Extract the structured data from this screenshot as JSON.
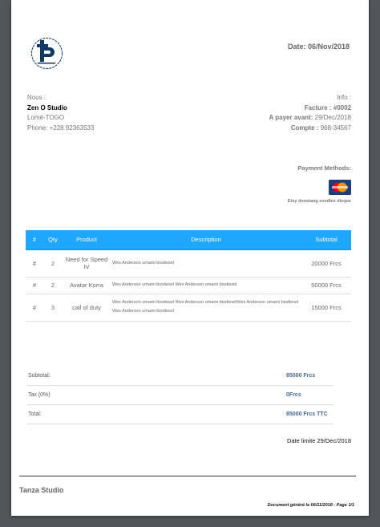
{
  "header": {
    "date": "Date: 06/Nov/2018"
  },
  "sender": {
    "label": "Nous :",
    "name": "Zen O Studio",
    "city": "Lomé-TOGO",
    "phone": "Phone: +228 92363533"
  },
  "info": {
    "label": "Info :",
    "invoice_label": "Facture :",
    "invoice_number": "#0002",
    "due_label": "A payer avant:",
    "due_date": "29/Dec/2018",
    "account_label": "Compte :",
    "account": "968-34567"
  },
  "payment": {
    "title": "Payment Methods:",
    "card_icon": "mastercard-icon",
    "card_text": "MasterCard",
    "note": "Etsy doostang zoodles disqus"
  },
  "table": {
    "headers": [
      "#",
      "Qty",
      "Product",
      "Description",
      "Subtotal"
    ],
    "rows": [
      {
        "num": "#",
        "qty": "2",
        "product": "Need for Speed IV",
        "description": "Wes Anderson umami biodiesel",
        "subtotal": "20000 Frcs"
      },
      {
        "num": "#",
        "qty": "2",
        "product": "Avatar Korra",
        "description": "Wes Anderson umami biodiesel Wes Anderson umami biodiesel",
        "subtotal": "50000 Frcs"
      },
      {
        "num": "#",
        "qty": "3",
        "product": "call of duty",
        "description": "Wes Anderson umami biodiesel Wes Anderson umami biodieselWes Anderson umami biodiesel Wes Anderson umami biodiesel",
        "subtotal": "15000 Frcs"
      }
    ]
  },
  "totals": [
    {
      "label": "Subtotal:",
      "value": "85000 Frcs"
    },
    {
      "label": "Tax (0%)",
      "value": "0Frcs"
    },
    {
      "label": "Total:",
      "value": "85000 Frcs TTC"
    }
  ],
  "deadline": "Date limite 29/Dec/2018",
  "footer": {
    "company": "Tanza Studio",
    "generated": "Document généré le 06/11/2018 - Page 1/1"
  },
  "colors": {
    "accent": "#1ea7fd",
    "logo": "#0d3b66",
    "viewer_bg": "#525659"
  }
}
